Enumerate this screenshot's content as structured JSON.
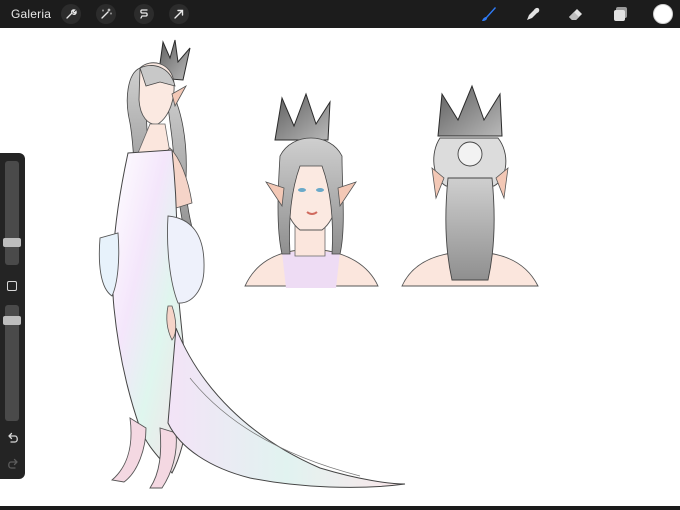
{
  "topbar": {
    "gallery_label": "Galeria",
    "left_tools": [
      "wrench-icon",
      "magic-wand-icon",
      "selection-icon",
      "transform-arrow-icon"
    ],
    "right_tools": [
      "brush-icon",
      "smudge-icon",
      "eraser-icon",
      "layers-icon"
    ],
    "active_tool": "brush-icon",
    "accent_color": "#2f7bf6",
    "current_color": "#ffffff"
  },
  "sidebar": {
    "brush_size_level": 0.22,
    "opacity_level": 0.52,
    "buttons": [
      "modify-square-icon",
      "undo-icon",
      "redo-icon"
    ]
  },
  "canvas": {
    "background": "#ffffff",
    "content": "character-design-sheet"
  }
}
